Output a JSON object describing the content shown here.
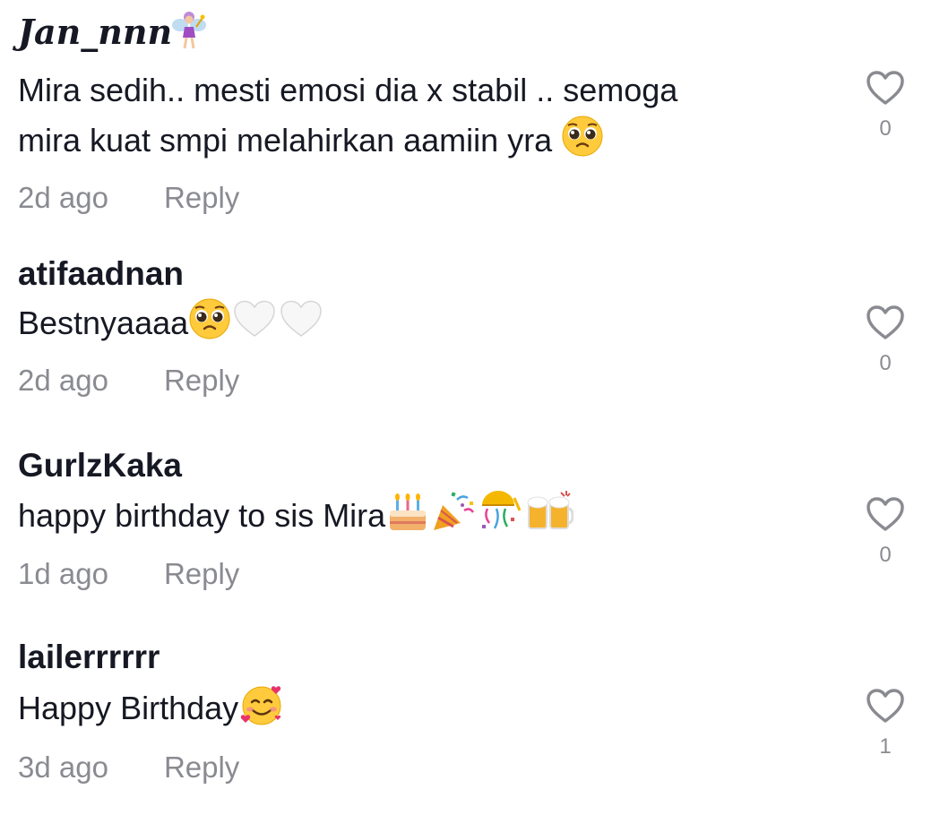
{
  "comments": [
    {
      "username": "Jan_nnn",
      "username_emoji": "fairy-icon",
      "text_lines": [
        "Mira sedih.. mesti emosi dia x stabil .. semoga",
        "mira kuat smpi melahirkan aamiin yra"
      ],
      "emojis": [
        "pleading-face-icon"
      ],
      "time": "2d ago",
      "reply_label": "Reply",
      "likes": "0"
    },
    {
      "username": "atifaadnan",
      "text": "Bestnyaaaa",
      "emojis": [
        "pleading-face-icon",
        "white-heart-icon",
        "white-heart-icon"
      ],
      "time": "2d ago",
      "reply_label": "Reply",
      "likes": "0"
    },
    {
      "username": "GurlzKaka",
      "text": "happy birthday to sis Mira",
      "emojis": [
        "birthday-cake-icon",
        "party-popper-icon",
        "confetti-ball-icon",
        "beer-mugs-icon"
      ],
      "time": "1d ago",
      "reply_label": "Reply",
      "likes": "0"
    },
    {
      "username": "lailerrrrrr",
      "text": "Happy Birthday",
      "emojis": [
        "smiling-face-with-hearts-icon"
      ],
      "time": "3d ago",
      "reply_label": "Reply",
      "likes": "1"
    }
  ],
  "colors": {
    "text": "#161823",
    "secondary": "#8a8b91",
    "heart_outline": "#8a8b91"
  }
}
